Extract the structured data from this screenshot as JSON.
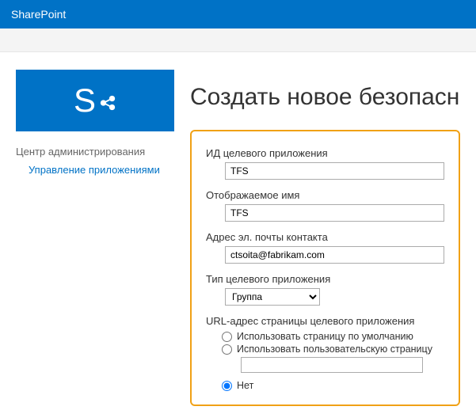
{
  "colors": {
    "brand": "#0072c6",
    "highlight": "#f0a116"
  },
  "app_title": "SharePoint",
  "logo_letter": "S",
  "nav": {
    "header": "Центр администрирования",
    "link_apps": "Управление приложениями"
  },
  "page_heading": "Создать новое безопасн…",
  "form": {
    "target_app_id": {
      "label": "ИД целевого приложения",
      "value": "TFS"
    },
    "display_name": {
      "label": "Отображаемое имя",
      "value": "TFS"
    },
    "contact_email": {
      "label": "Адрес эл. почты контакта",
      "value": "ctsoita@fabrikam.com"
    },
    "app_type": {
      "label": "Тип целевого приложения",
      "selected": "Группа"
    },
    "page_url": {
      "label": "URL-адрес страницы целевого приложения",
      "opt_default": "Использовать страницу по умолчанию",
      "opt_custom": "Использовать пользовательскую страницу",
      "opt_none": "Нет",
      "custom_value": "",
      "selected": "none"
    }
  }
}
